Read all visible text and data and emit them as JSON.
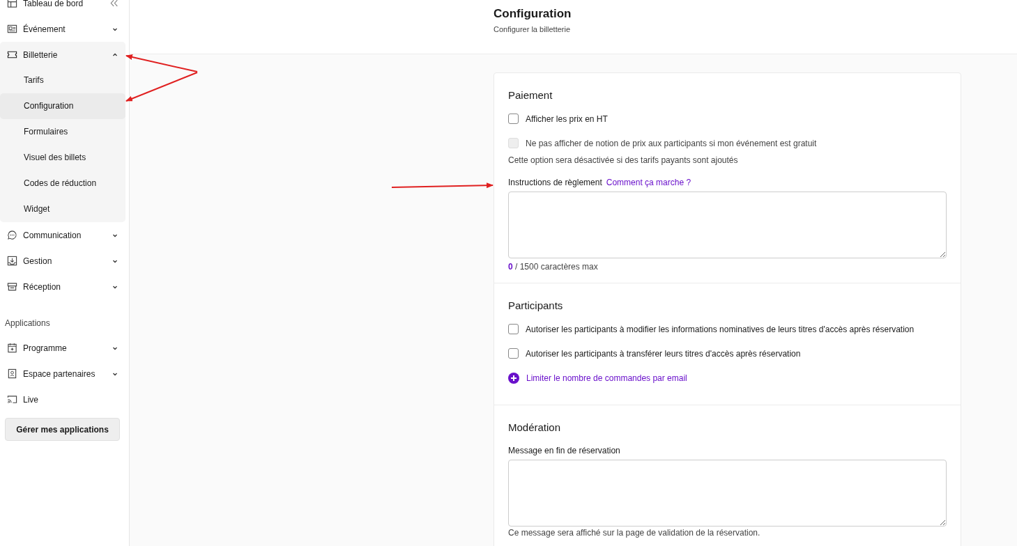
{
  "sidebar": {
    "nav": [
      {
        "label": "Tableau de bord"
      },
      {
        "label": "Événement",
        "expanded": false
      },
      {
        "label": "Billetterie",
        "expanded": true,
        "children": [
          {
            "label": "Tarifs",
            "selected": false
          },
          {
            "label": "Configuration",
            "selected": true
          },
          {
            "label": "Formulaires",
            "selected": false
          },
          {
            "label": "Visuel des billets",
            "selected": false
          },
          {
            "label": "Codes de réduction",
            "selected": false
          },
          {
            "label": "Widget",
            "selected": false
          }
        ]
      },
      {
        "label": "Communication",
        "expanded": false
      },
      {
        "label": "Gestion",
        "expanded": false
      },
      {
        "label": "Réception",
        "expanded": false
      }
    ],
    "apps_heading": "Applications",
    "apps": [
      {
        "label": "Programme",
        "expanded": false
      },
      {
        "label": "Espace partenaires",
        "expanded": false
      },
      {
        "label": "Live"
      }
    ],
    "apps_button": "Gérer mes applications"
  },
  "header": {
    "title": "Configuration",
    "subtitle": "Configurer la billetterie"
  },
  "sections": [
    {
      "title": "Paiement",
      "items": [
        {
          "kind": "checkbox",
          "label": "Afficher les prix en HT",
          "checked": false,
          "disabled": false
        },
        {
          "kind": "checkbox",
          "label": "Ne pas afficher de notion de prix aux participants si mon événement est gratuit",
          "checked": false,
          "disabled": true
        },
        {
          "kind": "note",
          "text": "Cette option sera désactivée si des tarifs payants sont ajoutés"
        },
        {
          "kind": "textarea",
          "label": "Instructions de règlement",
          "link": "Comment ça marche ?",
          "count": "0",
          "counter": "/ 1500 caractères max"
        }
      ]
    },
    {
      "title": "Participants",
      "items": [
        {
          "kind": "checkbox",
          "label": "Autoriser les participants à modifier les informations nominatives de leurs titres d'accès après réservation",
          "checked": false,
          "disabled": false
        },
        {
          "kind": "checkbox",
          "label": "Autoriser les participants à transférer leurs titres d'accès après réservation",
          "checked": false,
          "disabled": false
        },
        {
          "kind": "add_link",
          "label": "Limiter le nombre de commandes par email"
        }
      ]
    },
    {
      "title": "Modération",
      "items": [
        {
          "kind": "textarea",
          "label": "Message en fin de réservation",
          "helper": "Ce message sera affiché sur la page de validation de la réservation."
        }
      ]
    }
  ]
}
